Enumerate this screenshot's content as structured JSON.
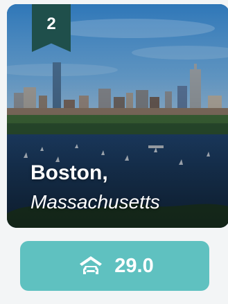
{
  "card": {
    "rank": "2",
    "city": "Boston,",
    "state": "Massachusetts"
  },
  "score": {
    "value": "29.0",
    "icon": "car-icon"
  },
  "colors": {
    "ribbon": "#1f4f4b",
    "score_button": "#5fc1c0",
    "text": "#ffffff"
  }
}
